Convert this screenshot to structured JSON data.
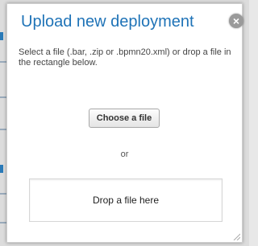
{
  "dialog": {
    "title": "Upload new deployment",
    "close_symbol": "×",
    "instructions": "Select a file (.bar, .zip or .bpmn20.xml) or drop a file in the rectangle below.",
    "choose_button_label": "Choose a file",
    "or_text": "or",
    "drop_zone_label": "Drop a file here"
  },
  "colors": {
    "title": "#1f73b7",
    "close_button": "#9a9a9a"
  },
  "icons": {
    "close": "close-icon",
    "resize": "resize-grip-icon"
  }
}
